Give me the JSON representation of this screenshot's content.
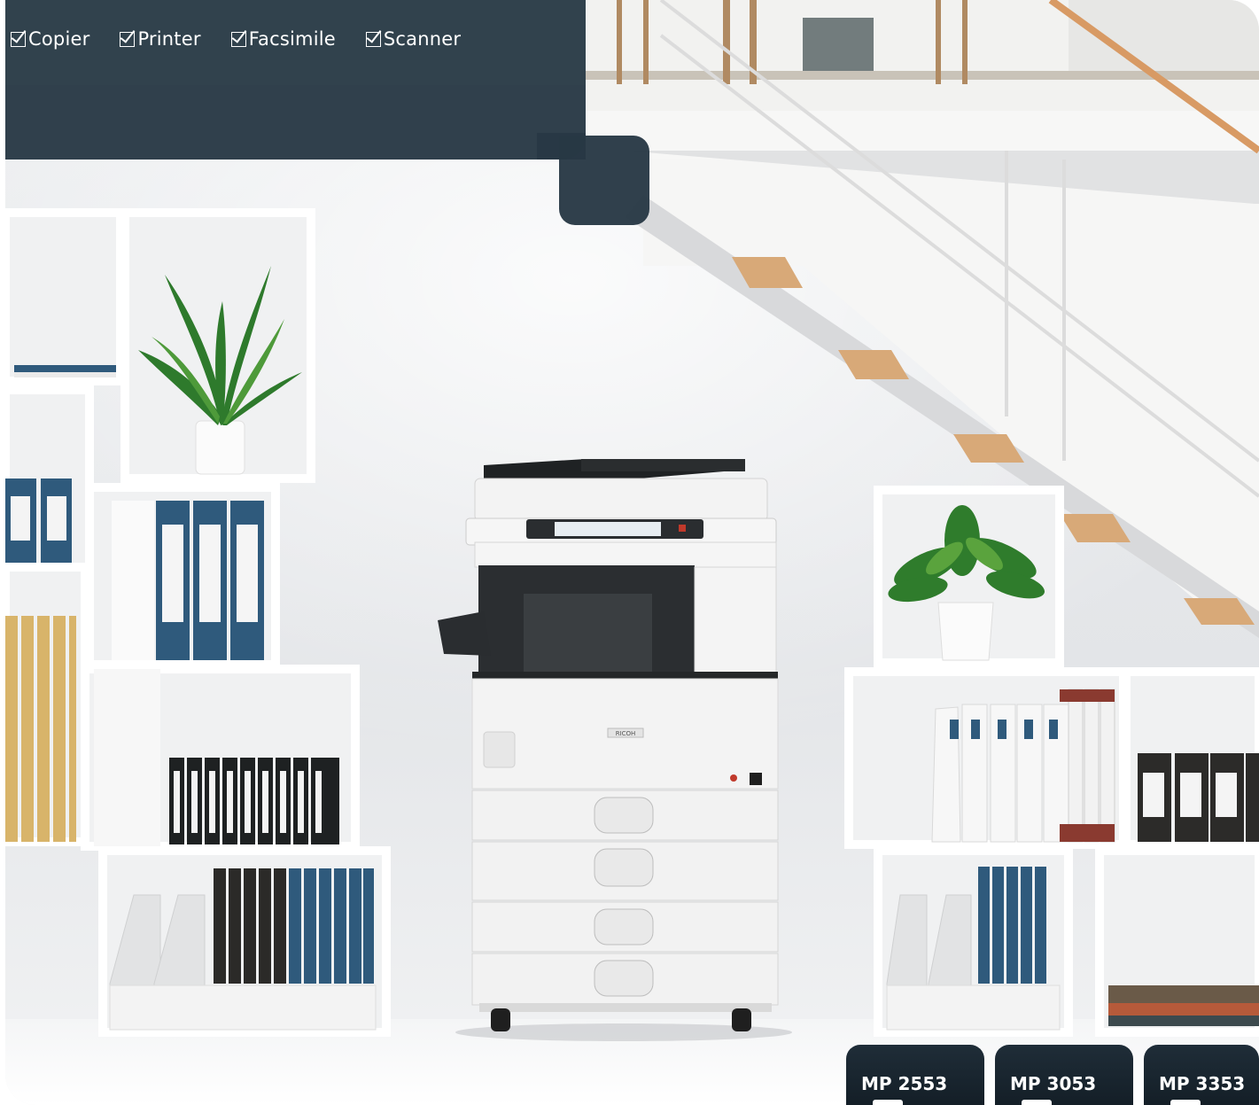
{
  "features": [
    {
      "label": "Copier",
      "icon": "checkbox-checked-icon"
    },
    {
      "label": "Printer",
      "icon": "checkbox-checked-icon"
    },
    {
      "label": "Facsimile",
      "icon": "checkbox-checked-icon"
    },
    {
      "label": "Scanner",
      "icon": "checkbox-checked-icon"
    }
  ],
  "models": [
    {
      "label": "MP 2553"
    },
    {
      "label": "MP 3053"
    },
    {
      "label": "MP 3353"
    }
  ],
  "device": {
    "brand": "RICOH"
  },
  "colors": {
    "panel": "#283845",
    "tab": "#1a2630",
    "binder_blue": "#2f5a7c",
    "wall": "#e9eaec"
  }
}
